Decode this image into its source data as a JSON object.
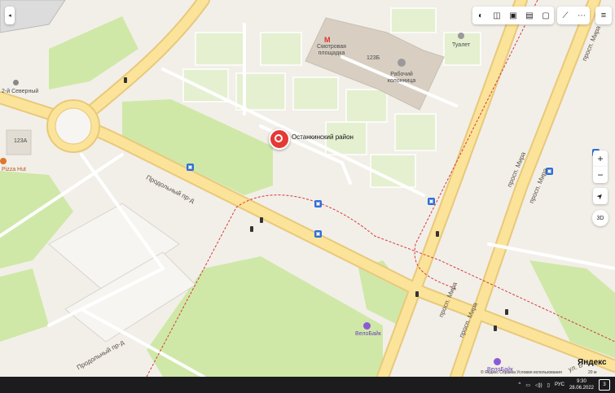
{
  "map": {
    "pin_label": "Останкинский район",
    "poi": {
      "metro_station": "Смотровая площадка",
      "toilet": "Туалет",
      "dropdown_well": "Рабочий колонница",
      "bike1": "ВелоБайк",
      "bike2": "ВелоБайк",
      "north2": "2-й Северный",
      "pizza": "Pizza Hut"
    },
    "building_numbers": [
      "123Б",
      "123А"
    ],
    "roads": {
      "prodolny": "Продольный пр-д",
      "prodolny2": "Продольный пр-д",
      "mira1": "просп. Мира",
      "mira2": "просп. Мира",
      "mira3": "просп. Мира",
      "mira4": "просп. Мира",
      "mira5": "просп. Мира",
      "ul_b": "ул. Б"
    },
    "brand": "Яндекс",
    "copyright": "© Яндекс  Справка  Условия использования",
    "scale": "20 м"
  },
  "controls": {
    "zoom_in": "+",
    "zoom_out": "−",
    "three_d": "3D"
  },
  "taskbar": {
    "lang": "РУС",
    "time": "9:30",
    "date": "28.06.2022",
    "notif": "3"
  }
}
